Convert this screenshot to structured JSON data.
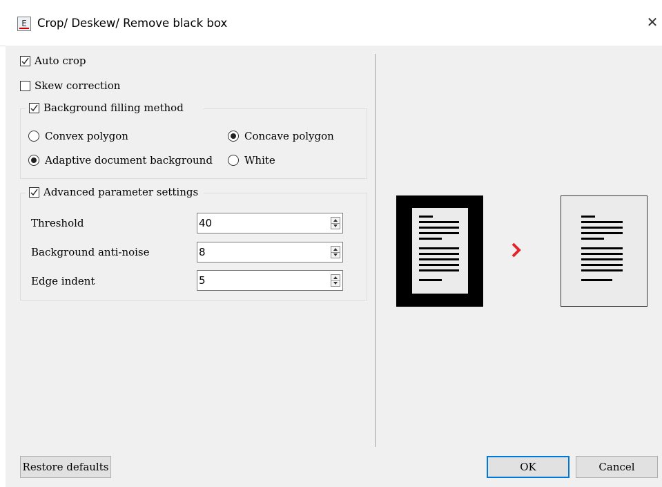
{
  "window": {
    "title": "Crop/ Deskew/ Remove black box",
    "icon_letter": "E"
  },
  "options": {
    "auto_crop": {
      "label": "Auto crop",
      "checked": true
    },
    "skew_correction": {
      "label": "Skew correction",
      "checked": false
    }
  },
  "background_filling": {
    "label": "Background filling method",
    "checked": true,
    "options": [
      {
        "label": "Convex polygon",
        "selected": false
      },
      {
        "label": "Concave polygon",
        "selected": true
      },
      {
        "label": "Adaptive document background",
        "selected": true
      },
      {
        "label": "White",
        "selected": false
      }
    ]
  },
  "advanced": {
    "label": "Advanced parameter settings",
    "checked": true,
    "params": [
      {
        "label": "Threshold",
        "value": "40"
      },
      {
        "label": "Background anti-noise",
        "value": "8"
      },
      {
        "label": "Edge indent",
        "value": "5"
      }
    ]
  },
  "preview": {
    "arrow_color": "#e0242a",
    "icons": [
      "document-with-black-border-icon",
      "chevron-right-icon",
      "cropped-document-icon"
    ]
  },
  "buttons": {
    "restore": "Restore defaults",
    "ok": "OK",
    "cancel": "Cancel"
  }
}
